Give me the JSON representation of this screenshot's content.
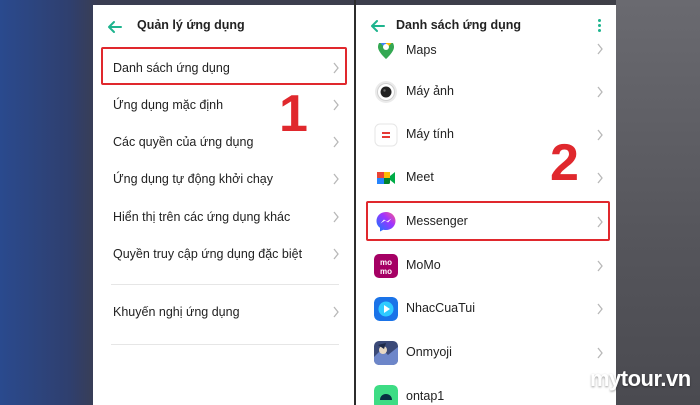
{
  "left_panel": {
    "title": "Quản lý ứng dụng",
    "items": [
      {
        "label": "Danh sách ứng dụng"
      },
      {
        "label": "Ứng dụng mặc định"
      },
      {
        "label": "Các quyền của ứng dụng"
      },
      {
        "label": "Ứng dụng tự động khởi chạy"
      },
      {
        "label": "Hiển thị trên các ứng dụng khác"
      },
      {
        "label": "Quyền truy cập ứng dụng đặc biệt"
      },
      {
        "label": "Khuyến nghị ứng dụng"
      }
    ],
    "step_number": "1"
  },
  "right_panel": {
    "title": "Danh sách ứng dụng",
    "apps": [
      {
        "label": "Maps",
        "icon": "google-maps-icon"
      },
      {
        "label": "Máy ảnh",
        "icon": "camera-icon"
      },
      {
        "label": "Máy tính",
        "icon": "calculator-icon"
      },
      {
        "label": "Meet",
        "icon": "google-meet-icon"
      },
      {
        "label": "Messenger",
        "icon": "messenger-icon"
      },
      {
        "label": "MoMo",
        "icon": "momo-icon"
      },
      {
        "label": "NhacCuaTui",
        "icon": "nhaccuatui-icon"
      },
      {
        "label": "Onmyoji",
        "icon": "onmyoji-icon"
      },
      {
        "label": "ontap1",
        "icon": "android-app-icon"
      }
    ],
    "step_number": "2"
  },
  "watermark": "mytour.vn",
  "colors": {
    "highlight": "#e0282d",
    "accent": "#1eb48e"
  }
}
